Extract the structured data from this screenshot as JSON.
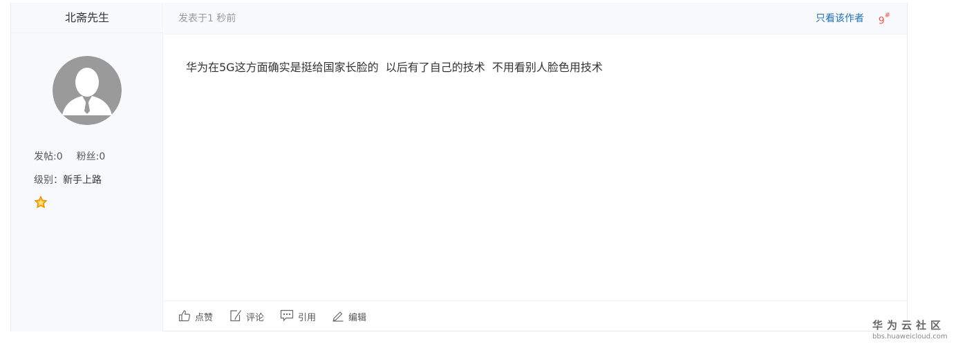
{
  "author": {
    "name": "北斋先生",
    "posts_label": "发帖:0",
    "fans_label": "粉丝:0",
    "level_key": "级别：",
    "level_value": "新手上路"
  },
  "post": {
    "posted_time": "发表于1 秒前",
    "only_author_label": "只看该作者",
    "floor_number": "9",
    "floor_mark": "#",
    "content": "华为在5G这方面确实是挺给国家长脸的  以后有了自己的技术  不用看别人脸色用技术"
  },
  "actions": {
    "like_label": "点赞",
    "comment_label": "评论",
    "quote_label": "引用",
    "edit_label": "编辑"
  },
  "watermark": {
    "title": "华为云社区",
    "url": "bbs.huaweicloud.com"
  },
  "colors": {
    "link": "#1f6fb3",
    "floor": "#e85b4b",
    "panel": "#f7f9fc"
  }
}
